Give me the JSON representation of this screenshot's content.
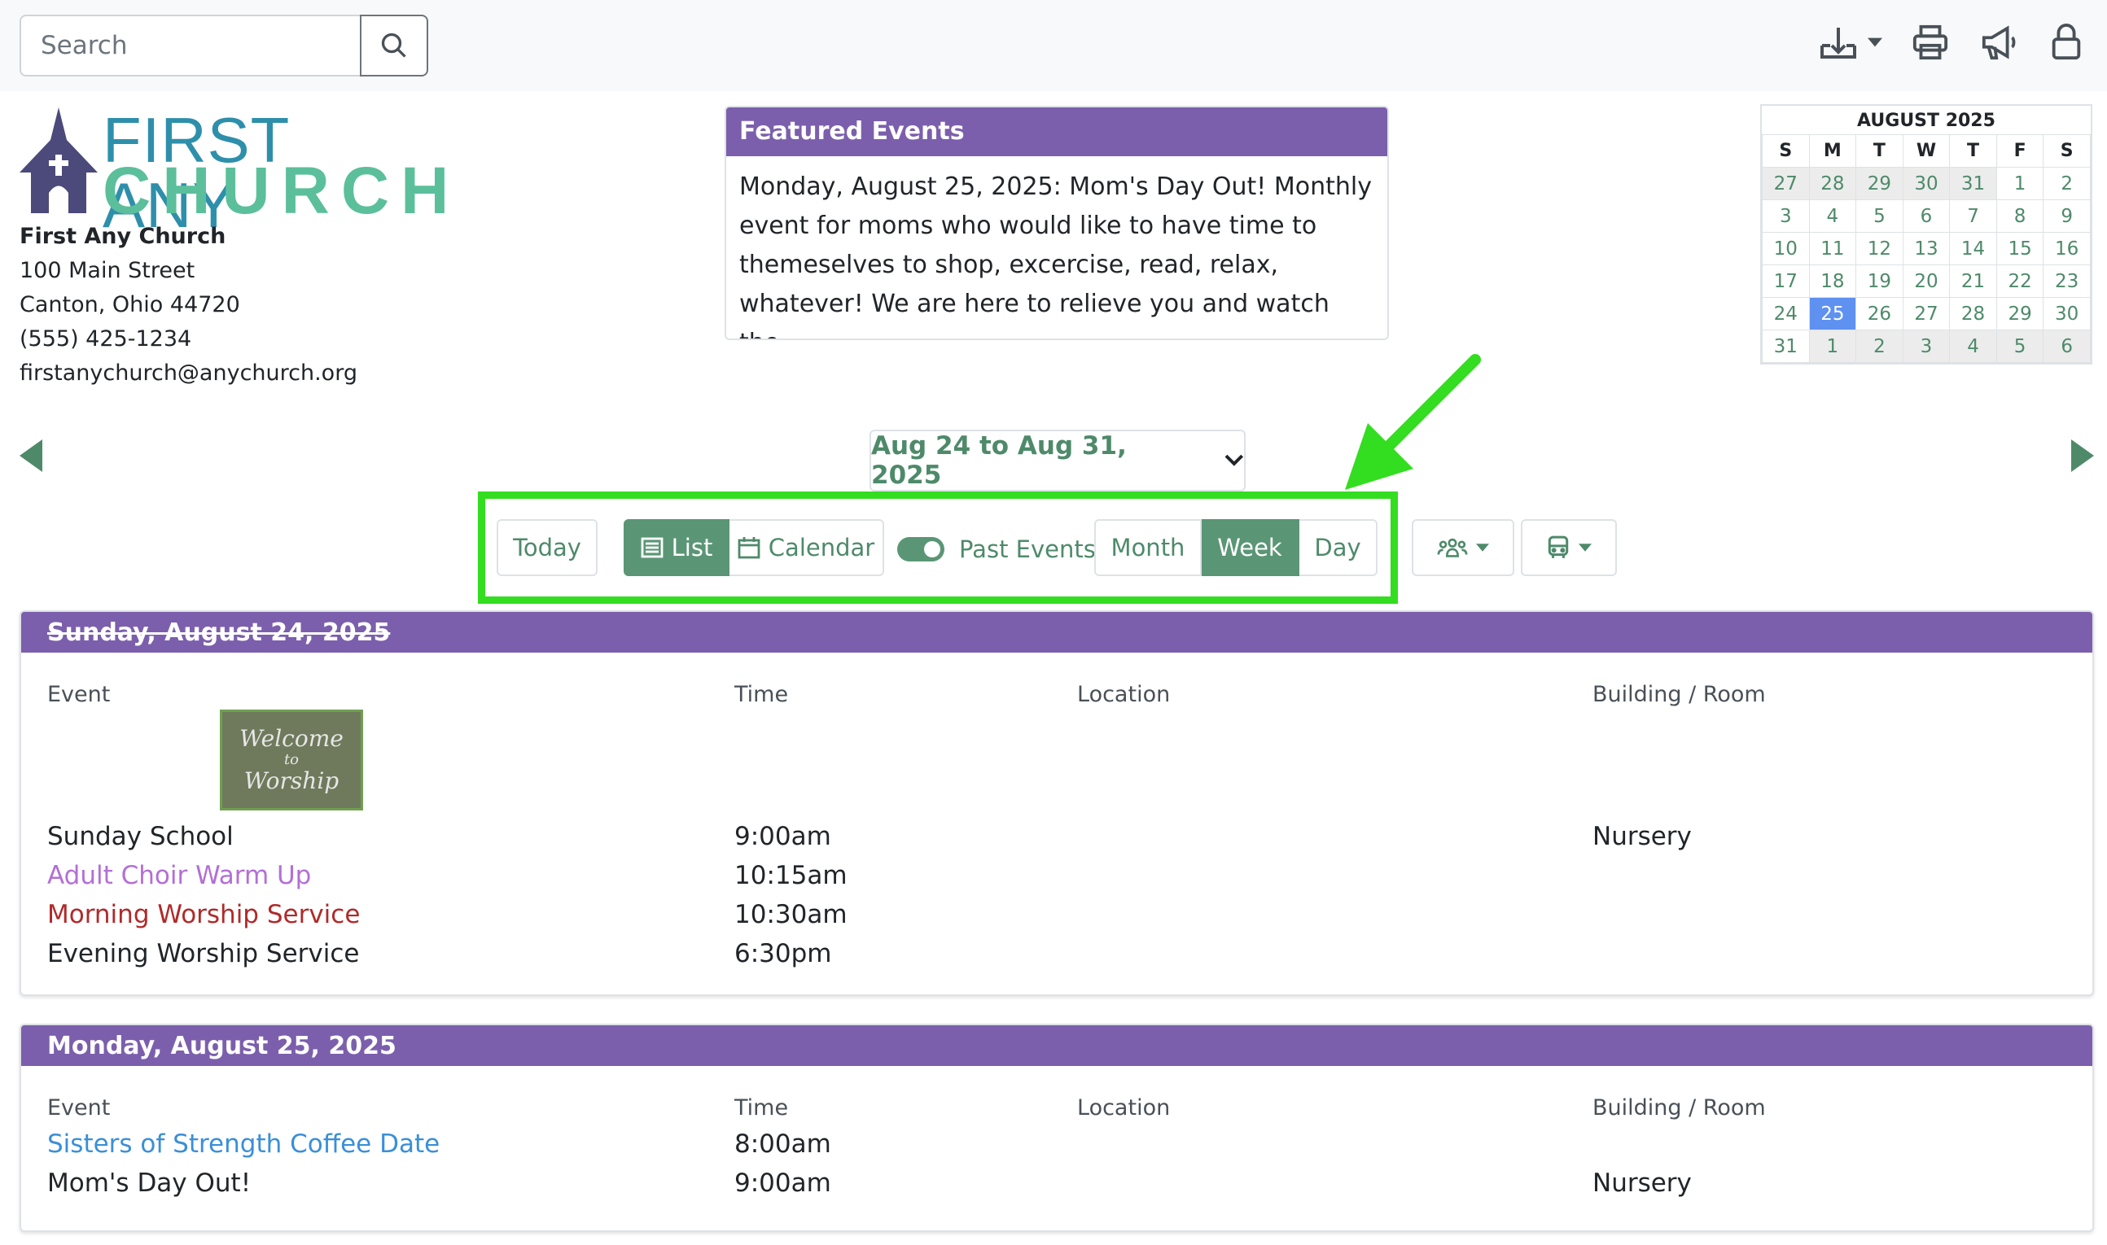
{
  "search": {
    "placeholder": "Search"
  },
  "toolbar_icons": [
    "download-icon",
    "print-icon",
    "megaphone-icon",
    "lock-icon"
  ],
  "church": {
    "logo_top": "FIRST ANY",
    "logo_bottom": "CHURCH",
    "name": "First Any Church",
    "address": "100 Main Street",
    "city": "Canton, Ohio 44720",
    "phone": "(555) 425-1234",
    "email": "firstanychurch@anychurch.org"
  },
  "featured": {
    "title": "Featured Events",
    "body": "Monday, August 25, 2025: Mom's Day Out! Monthly event for moms who would like to have time to themeselves to shop, excercise, read, relax, whatever! We are here to relieve you and watch the"
  },
  "mini_calendar": {
    "title": "AUGUST 2025",
    "weekdays": [
      "S",
      "M",
      "T",
      "W",
      "T",
      "F",
      "S"
    ],
    "weeks": [
      [
        "27",
        "28",
        "29",
        "30",
        "31",
        "1",
        "2"
      ],
      [
        "3",
        "4",
        "5",
        "6",
        "7",
        "8",
        "9"
      ],
      [
        "10",
        "11",
        "12",
        "13",
        "14",
        "15",
        "16"
      ],
      [
        "17",
        "18",
        "19",
        "20",
        "21",
        "22",
        "23"
      ],
      [
        "24",
        "25",
        "26",
        "27",
        "28",
        "29",
        "30"
      ],
      [
        "31",
        "1",
        "2",
        "3",
        "4",
        "5",
        "6"
      ]
    ],
    "today": "25"
  },
  "date_range": "Aug 24 to Aug 31, 2025",
  "controls": {
    "today": "Today",
    "list": "List",
    "calendar": "Calendar",
    "past_events": "Past Events",
    "month": "Month",
    "week": "Week",
    "day": "Day"
  },
  "colors": {
    "header_purple": "#7b5fac",
    "accent_green": "#5a9675",
    "highlight_green": "#33dd1f"
  },
  "columns": {
    "event": "Event",
    "time": "Time",
    "location": "Location",
    "room": "Building / Room"
  },
  "days": [
    {
      "title": "Sunday, August 24, 2025",
      "image_text": [
        "Welcome",
        "to",
        "Worship"
      ],
      "events": [
        {
          "name": "Sunday School",
          "time": "9:00am",
          "location": "",
          "room": "Nursery"
        },
        {
          "name": "Adult Choir Warm Up",
          "time": "10:15am",
          "location": "",
          "room": ""
        },
        {
          "name": "Morning Worship Service",
          "time": "10:30am",
          "location": "",
          "room": ""
        },
        {
          "name": "Evening Worship Service",
          "time": "6:30pm",
          "location": "",
          "room": ""
        }
      ]
    },
    {
      "title": "Monday, August 25, 2025",
      "events": [
        {
          "name": "Sisters of Strength Coffee Date",
          "time": "8:00am",
          "location": "",
          "room": ""
        },
        {
          "name": "Mom's Day Out!",
          "time": "9:00am",
          "location": "",
          "room": "Nursery"
        }
      ]
    }
  ]
}
